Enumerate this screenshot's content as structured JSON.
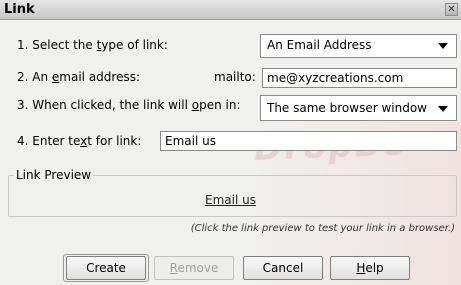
{
  "dialog": {
    "title": "Link",
    "close_glyph": "✕"
  },
  "step1": {
    "label_pre": "1. Select the ",
    "label_mnemonic": "t",
    "label_post": "ype of link:",
    "selected": "An Email Address"
  },
  "step2": {
    "label_pre": "2. An ",
    "label_mnemonic": "e",
    "label_post": "mail address:",
    "prefix": "mailto:",
    "value": "me@xyzcreations.com"
  },
  "step3": {
    "label_pre": "3. When clicked, the link will ",
    "label_mnemonic": "o",
    "label_post": "pen in:",
    "selected": "The same browser window"
  },
  "step4": {
    "label_pre": "4. Enter te",
    "label_mnemonic": "x",
    "label_post": "t for link:",
    "value": "Email us"
  },
  "preview": {
    "legend": "Link Preview",
    "link_text": "Email us",
    "note": "(Click the link preview to test your link in a browser.)"
  },
  "watermark": {
    "text": "DropBo"
  },
  "buttons": {
    "create": "Create",
    "remove_mnemonic": "R",
    "remove_rest": "emove",
    "cancel": "Cancel",
    "help_mnemonic": "H",
    "help_rest": "elp"
  }
}
